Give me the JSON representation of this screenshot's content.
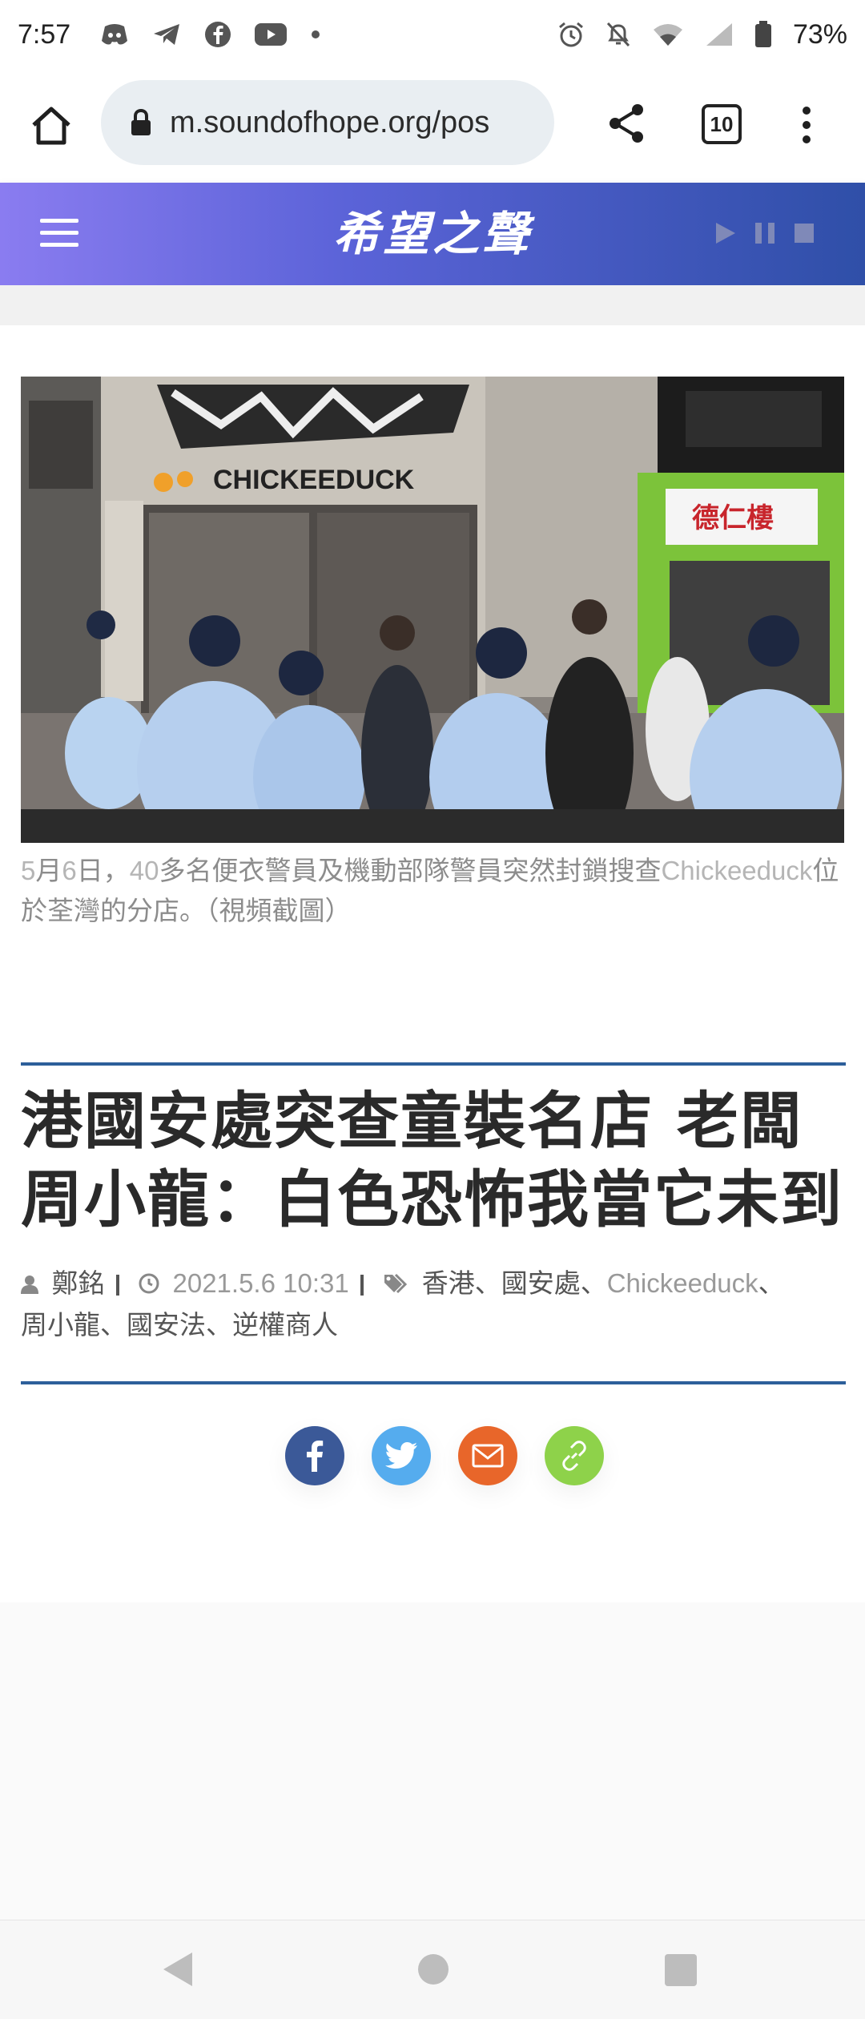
{
  "status_bar": {
    "time": "7:57",
    "battery": "73%",
    "left_icons": [
      "discord-icon",
      "telegram-icon",
      "facebook-icon",
      "youtube-icon",
      "dot-icon"
    ],
    "right_icons": [
      "alarm-icon",
      "mute-icon",
      "wifi-icon",
      "signal-icon",
      "battery-icon"
    ]
  },
  "browser": {
    "url": "m.soundofhope.org/pos",
    "tab_count": "10"
  },
  "site": {
    "logo_text": "希望之聲",
    "colors": {
      "header_start": "#8a7cf0",
      "header_end": "#2f4fa8",
      "accent_rule": "#2d5f9a"
    }
  },
  "article": {
    "photo": {
      "store_sign": "CHICKEEDUCK",
      "shop_sign_right": "德仁樓"
    },
    "caption_parts": [
      {
        "text": "5",
        "style": "latin"
      },
      {
        "text": "月",
        "style": "cjk"
      },
      {
        "text": "6",
        "style": "latin"
      },
      {
        "text": "日，",
        "style": "cjk"
      },
      {
        "text": "40",
        "style": "latin"
      },
      {
        "text": "多名便衣警員及機動部隊警員突然封鎖搜查",
        "style": "cjk"
      },
      {
        "text": "Chickeeduck",
        "style": "latin"
      },
      {
        "text": "位於荃灣的分店。（視頻截圖）",
        "style": "cjk"
      }
    ],
    "headline_line1": "港國安處突查童裝名店 老闆",
    "headline_line2": "周小龍：白色恐怖我當它未到",
    "author": "鄭銘",
    "date": "2021.5.6 10:31",
    "tags": [
      "香港",
      "國安處",
      "Chickeeduck",
      "周小龍",
      "國安法",
      "逆權商人"
    ],
    "tag_separator": "、",
    "share": [
      {
        "name": "facebook",
        "color": "#3b5998"
      },
      {
        "name": "twitter",
        "color": "#55acee"
      },
      {
        "name": "email",
        "color": "#e8662a"
      },
      {
        "name": "link",
        "color": "#8ed24a"
      }
    ]
  }
}
